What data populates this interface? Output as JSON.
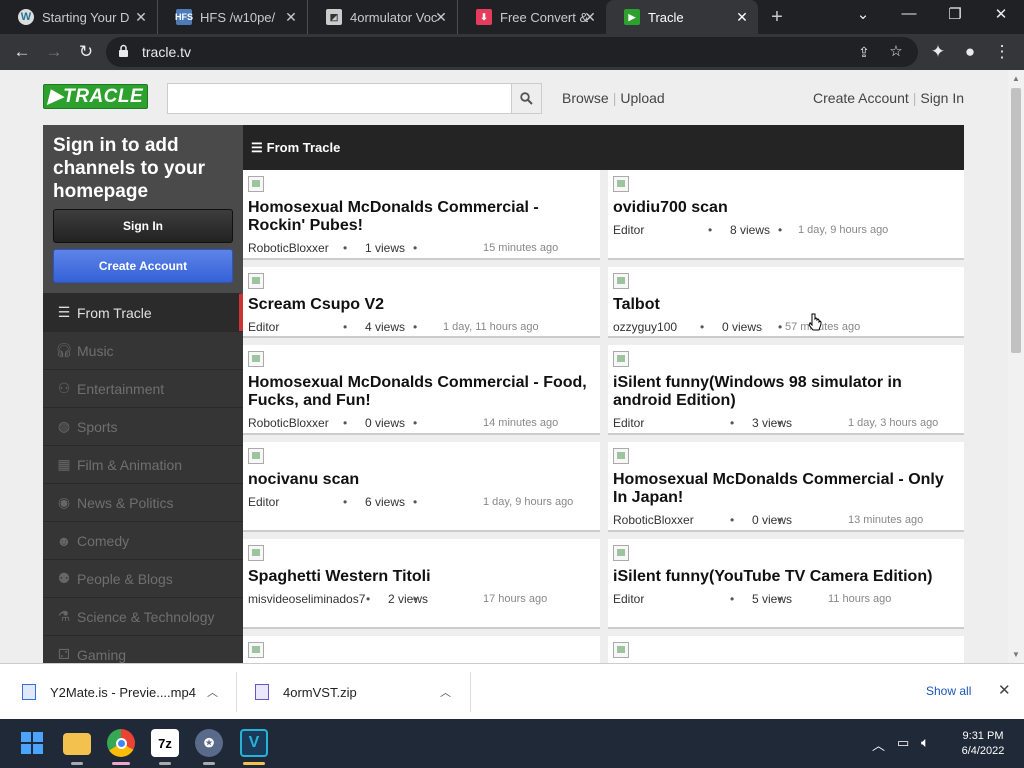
{
  "browser": {
    "tabs": [
      {
        "title": "Starting Your Do",
        "icon": "wordpress-icon"
      },
      {
        "title": "HFS /w10pe/",
        "icon": "hfs-icon"
      },
      {
        "title": "4ormulator Voc",
        "icon": "forum-icon"
      },
      {
        "title": "Free Convert &",
        "icon": "download-arrow-icon"
      },
      {
        "title": "Tracle",
        "icon": "tracle-play-icon",
        "active": true
      }
    ],
    "url": "tracle.tv"
  },
  "site": {
    "logo": "TRACLE",
    "search_placeholder": "",
    "nav": [
      "Browse",
      "Upload"
    ],
    "account": [
      "Create Account",
      "Sign In"
    ],
    "colors": {
      "logo": "#2da02d",
      "create_button": "#3f6ee0",
      "active_marker": "#cc3333"
    }
  },
  "sidebar": {
    "signin_heading": "Sign in to add channels to your homepage",
    "signin_button": "Sign In",
    "create_button": "Create Account",
    "categories": [
      {
        "label": "From Tracle",
        "icon": "list-icon",
        "active": true
      },
      {
        "label": "Music",
        "icon": "headphones-icon"
      },
      {
        "label": "Entertainment",
        "icon": "gamepad-icon"
      },
      {
        "label": "Sports",
        "icon": "ball-icon"
      },
      {
        "label": "Film & Animation",
        "icon": "film-icon"
      },
      {
        "label": "News & Politics",
        "icon": "broadcast-icon"
      },
      {
        "label": "Comedy",
        "icon": "mask-icon"
      },
      {
        "label": "People & Blogs",
        "icon": "people-icon"
      },
      {
        "label": "Science & Technology",
        "icon": "flask-icon"
      },
      {
        "label": "Gaming",
        "icon": "controller-icon"
      }
    ]
  },
  "content": {
    "heading": "From Tracle",
    "videos": [
      {
        "title": "Homosexual McDonalds Commercial - Rockin' Pubes!",
        "author": "RoboticBloxxer",
        "views": "1 views",
        "ago": "15 minutes ago"
      },
      {
        "title": "ovidiu700 scan",
        "author": "Editor",
        "views": "8 views",
        "ago": "1 day, 9 hours ago"
      },
      {
        "title": "Scream Csupo V2",
        "author": "Editor",
        "views": "4 views",
        "ago": "1 day, 11 hours ago"
      },
      {
        "title": "Talbot",
        "author": "ozzyguy100",
        "views": "0 views",
        "ago": "57 minutes ago"
      },
      {
        "title": "Homosexual McDonalds Commercial - Food, Fucks, and Fun!",
        "author": "RoboticBloxxer",
        "views": "0 views",
        "ago": "14 minutes ago"
      },
      {
        "title": "iSilent funny(Windows 98 simulator in android Edition)",
        "author": "Editor",
        "views": "3 views",
        "ago": "1 day, 3 hours ago"
      },
      {
        "title": "nocivanu scan",
        "author": "Editor",
        "views": "6 views",
        "ago": "1 day, 9 hours ago"
      },
      {
        "title": "Homosexual McDonalds Commercial - Only In Japan!",
        "author": "RoboticBloxxer",
        "views": "0 views",
        "ago": "13 minutes ago"
      },
      {
        "title": "Spaghetti Western Titoli",
        "author": "misvideoseliminados7",
        "views": "2 views",
        "ago": "17 hours ago"
      },
      {
        "title": "iSilent funny(YouTube TV Camera Edition)",
        "author": "Editor",
        "views": "5 views",
        "ago": "11 hours ago"
      },
      {
        "title": "",
        "author": "",
        "views": "",
        "ago": ""
      },
      {
        "title": "",
        "author": "",
        "views": "",
        "ago": ""
      }
    ]
  },
  "downloads": {
    "items": [
      {
        "name": "Y2Mate.is - Previe....mp4"
      },
      {
        "name": "4ormVST.zip"
      }
    ],
    "show_all": "Show all"
  },
  "taskbar": {
    "time": "9:31 PM",
    "date": "6/4/2022",
    "apps": [
      "windows-start-icon",
      "file-explorer-icon",
      "chrome-icon",
      "7zip-icon",
      "app-icon",
      "vst-icon"
    ]
  }
}
